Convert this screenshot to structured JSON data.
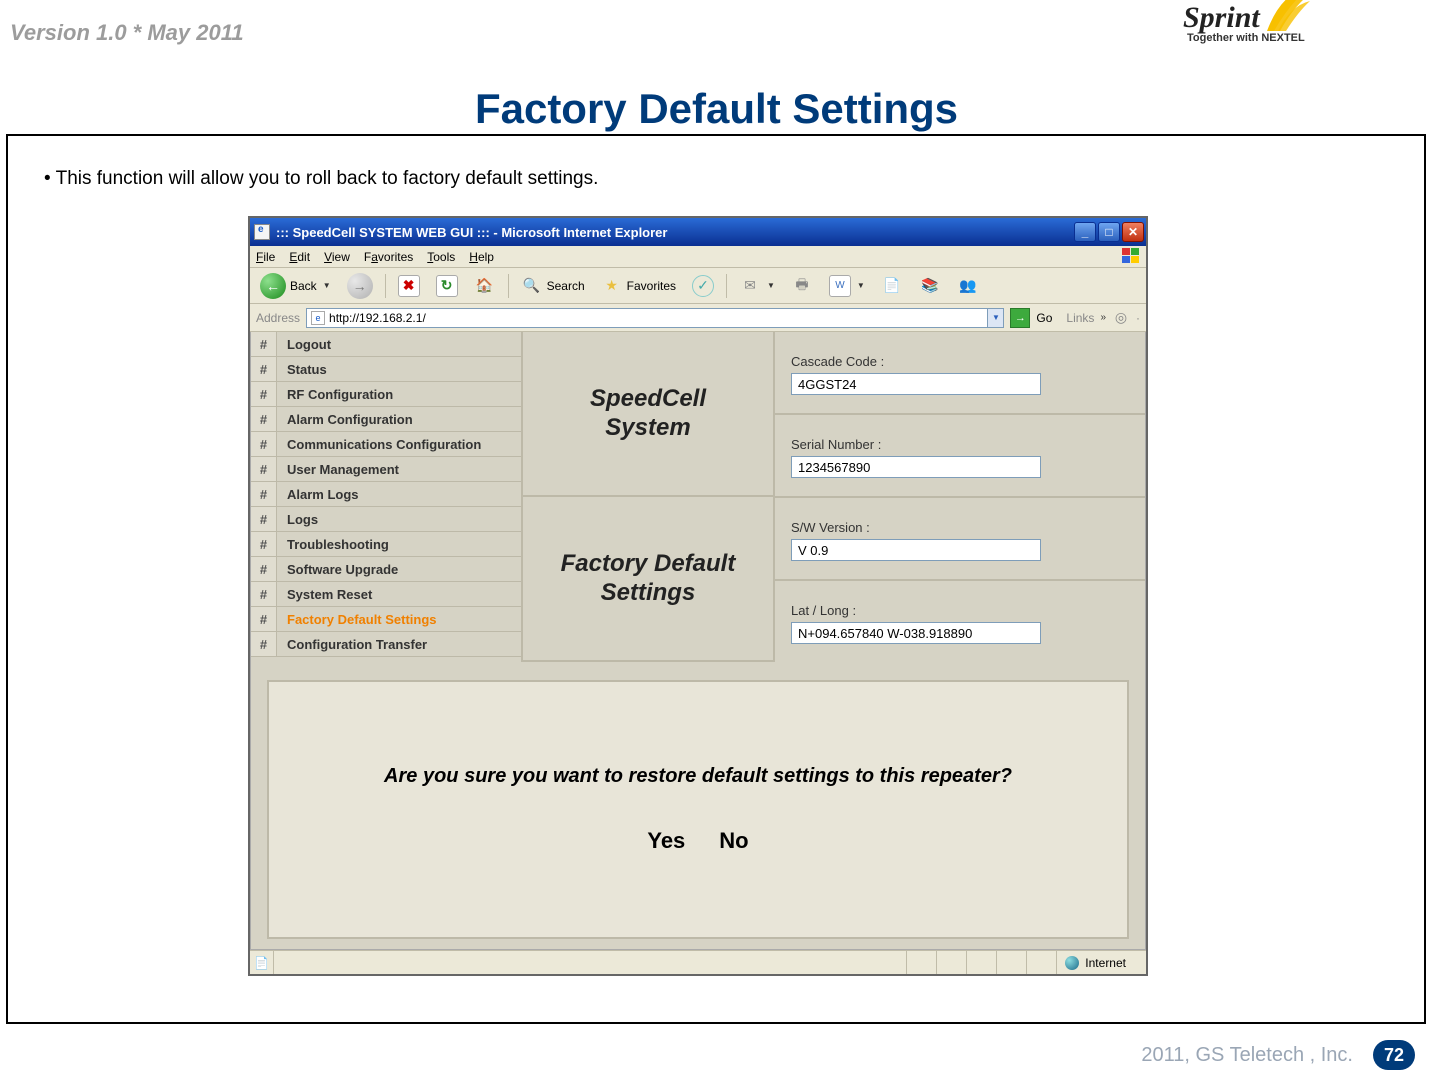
{
  "doc": {
    "version_label": "Version 1.0 * May 2011",
    "logo_word": "Sprint",
    "logo_tag": "Together with NEXTEL",
    "page_title": "Factory Default Settings",
    "description": "• This function will allow you to roll back to factory default settings.",
    "footer_text": "2011, GS Teletech , Inc.",
    "page_number": "72"
  },
  "browser": {
    "window_title": "::: SpeedCell SYSTEM WEB GUI ::: - Microsoft Internet Explorer",
    "menus": {
      "file": "File",
      "edit": "Edit",
      "view": "View",
      "favorites": "Favorites",
      "tools": "Tools",
      "help": "Help"
    },
    "toolbar": {
      "back": "Back",
      "search": "Search",
      "favorites": "Favorites"
    },
    "address_label": "Address",
    "address_url": "http://192.168.2.1/",
    "go_label": "Go",
    "links_label": "Links",
    "status_zone": "Internet"
  },
  "app": {
    "sidebar": [
      "Logout",
      "Status",
      "RF Configuration",
      "Alarm Configuration",
      "Communications Configuration",
      "User Management",
      "Alarm Logs",
      "Logs",
      "Troubleshooting",
      "Software Upgrade",
      "System Reset",
      "Factory Default Settings",
      "Configuration Transfer"
    ],
    "active_index": 11,
    "mid_top": "SpeedCell\nSystem",
    "mid_bottom": "Factory Default\nSettings",
    "fields": {
      "cascade_label": "Cascade Code :",
      "cascade_value": "4GGST24",
      "serial_label": "Serial Number :",
      "serial_value": "1234567890",
      "sw_label": "S/W Version :",
      "sw_value": "V 0.9",
      "latlong_label": "Lat / Long :",
      "latlong_value": "N+094.657840 W-038.918890"
    },
    "confirm_text": "Are you sure you want to restore default settings to this repeater?",
    "yes_label": "Yes",
    "no_label": "No"
  }
}
